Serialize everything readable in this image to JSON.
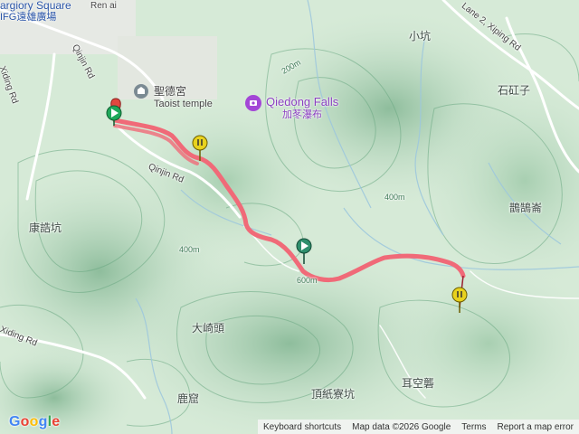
{
  "map": {
    "colors": {
      "terrain": "#cfe6d2",
      "ridge_dark": "#7fb592",
      "road": "#ffffff",
      "stream": "#9cc6de",
      "route": "#f06a78",
      "start_marker": "#1fa85a",
      "end_marker": "#e0483f",
      "waypoint": "#e8d21e",
      "mid_marker": "#2f8f6d"
    },
    "place_labels": {
      "mall_en": "argiory Square",
      "mall_zh": "IFG遠雄廣場",
      "ren_road": "Ren ai",
      "qinjin_rd_top": "Qinjin Rd",
      "xiding_rd": "Xiding Rd",
      "shengde_temple": "聖德宮",
      "taoist_temple": "Taoist temple",
      "qiedong_falls": "Qiedong Falls",
      "qiedong_falls_zh": "加苳瀑布",
      "qinjin_rd_mid": "Qinjin Rd",
      "kangjie_keng": "康誥坑",
      "xiding_rd_low": "Xiding Rd",
      "daqi_tou": "大崎頭",
      "lu_ku": "鹿窟",
      "dingzhi_liao_keng": "頂紙寮坑",
      "er_kong_long": "耳空礱",
      "xiao_keng": "小坑",
      "shi_kong_zi": "石矼子",
      "xiping_rd": "Lane 2, Xiping Rd",
      "gu_gu_lun": "鵲鵠崙",
      "contour_400": "400m",
      "contour_400b": "400m",
      "contour_200": "200m",
      "contour_600": "600m"
    },
    "footer": {
      "keyboard": "Keyboard shortcuts",
      "mapdata": "Map data ©2026 Google",
      "terms": "Terms",
      "report": "Report a map error"
    },
    "google": [
      "G",
      "o",
      "o",
      "g",
      "l",
      "e"
    ]
  }
}
